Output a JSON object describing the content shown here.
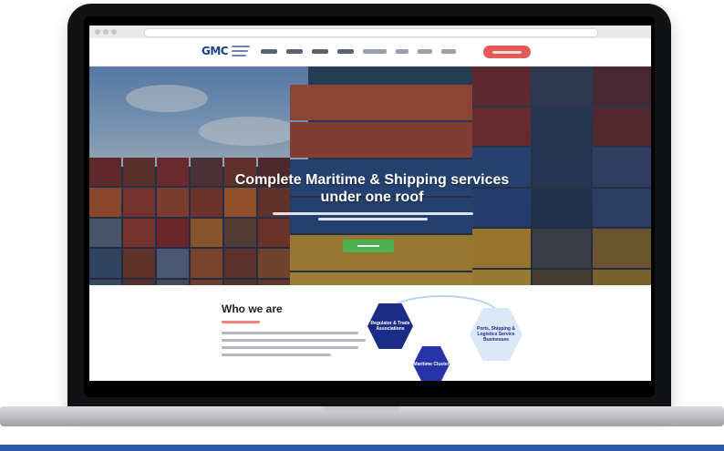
{
  "site": {
    "logo_text": "GMC",
    "hero_title": "Complete Maritime & Shipping services under one roof",
    "about_title": "Who we are"
  },
  "diagram": {
    "center_label": "Maritime Cluster",
    "hex_left": "Regulator & Trade Associations",
    "hex_right": "Ports, Shipping & Logistics Service Businesses"
  },
  "colors": {
    "accent_blue": "#1c2b86",
    "cta_red": "#e45a5a",
    "cta_green": "#4caf50",
    "footer_blue": "#2f58a8"
  },
  "icons": [
    "laptop",
    "browser-window",
    "logo-mark"
  ]
}
